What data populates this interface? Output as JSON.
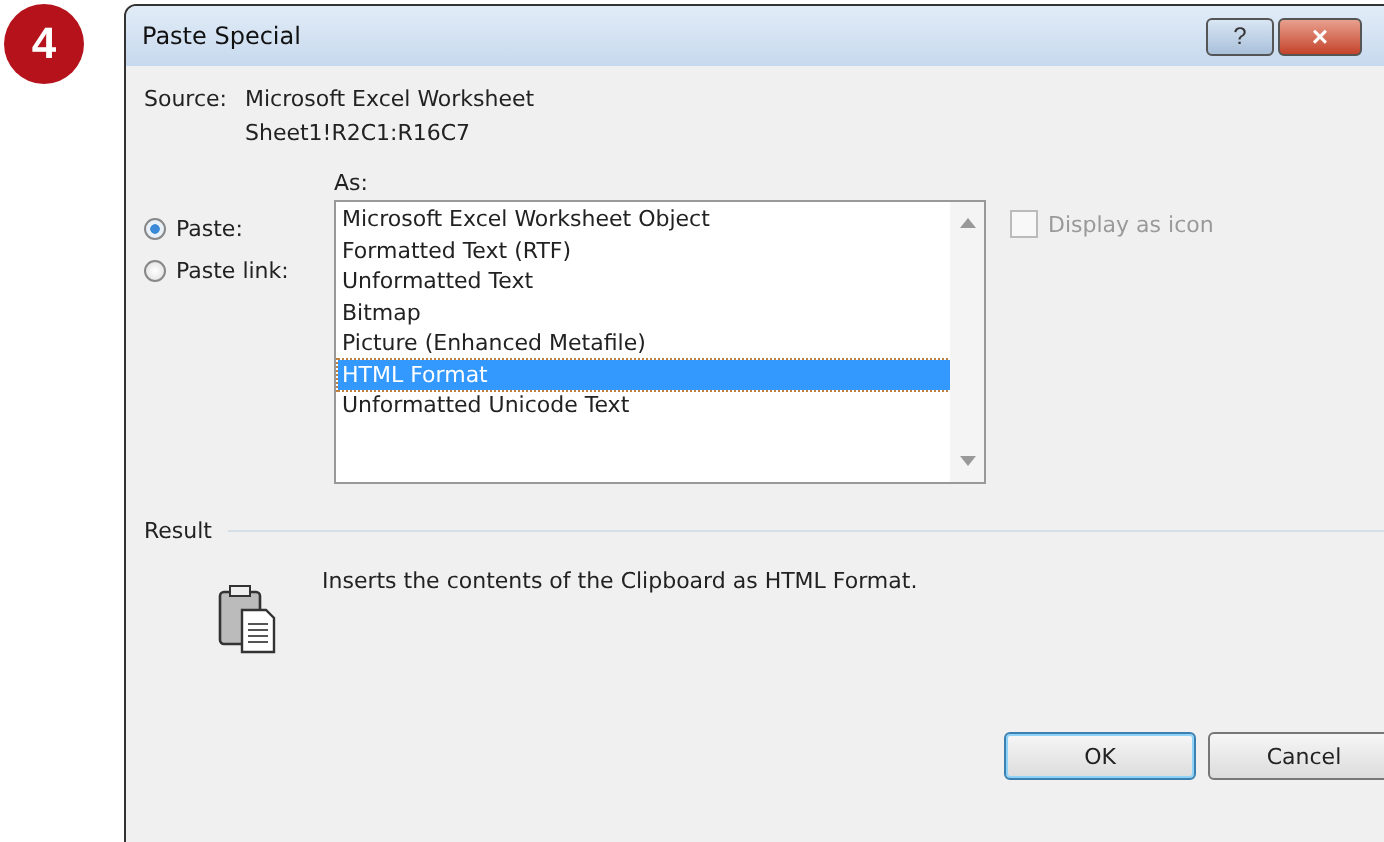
{
  "step_badge": "4",
  "window": {
    "title": "Paste Special",
    "buttons": [
      "?",
      "×"
    ]
  },
  "source": {
    "label": "Source:",
    "lines": [
      "Microsoft Excel Worksheet",
      "Sheet1!R2C1:R16C7"
    ]
  },
  "paste_options": [
    {
      "label": "Paste:",
      "selected": true
    },
    {
      "label": "Paste link:",
      "selected": false
    }
  ],
  "as_list": {
    "label": "As:",
    "items": [
      {
        "label": "Microsoft Excel Worksheet Object",
        "selected": false
      },
      {
        "label": "Formatted Text (RTF)",
        "selected": false
      },
      {
        "label": "Unformatted Text",
        "selected": false
      },
      {
        "label": "Bitmap",
        "selected": false
      },
      {
        "label": "Picture (Enhanced Metafile)",
        "selected": false
      },
      {
        "label": "HTML Format",
        "selected": true
      },
      {
        "label": "Unformatted Unicode Text",
        "selected": false
      }
    ]
  },
  "display_as_icon": {
    "label": "Display as icon",
    "checked": false,
    "disabled": true
  },
  "result": {
    "label": "Result",
    "text": "Inserts the contents of the Clipboard as HTML Format."
  },
  "buttons": [
    {
      "label": "OK",
      "default": true
    },
    {
      "label": "Cancel",
      "default": false
    }
  ]
}
